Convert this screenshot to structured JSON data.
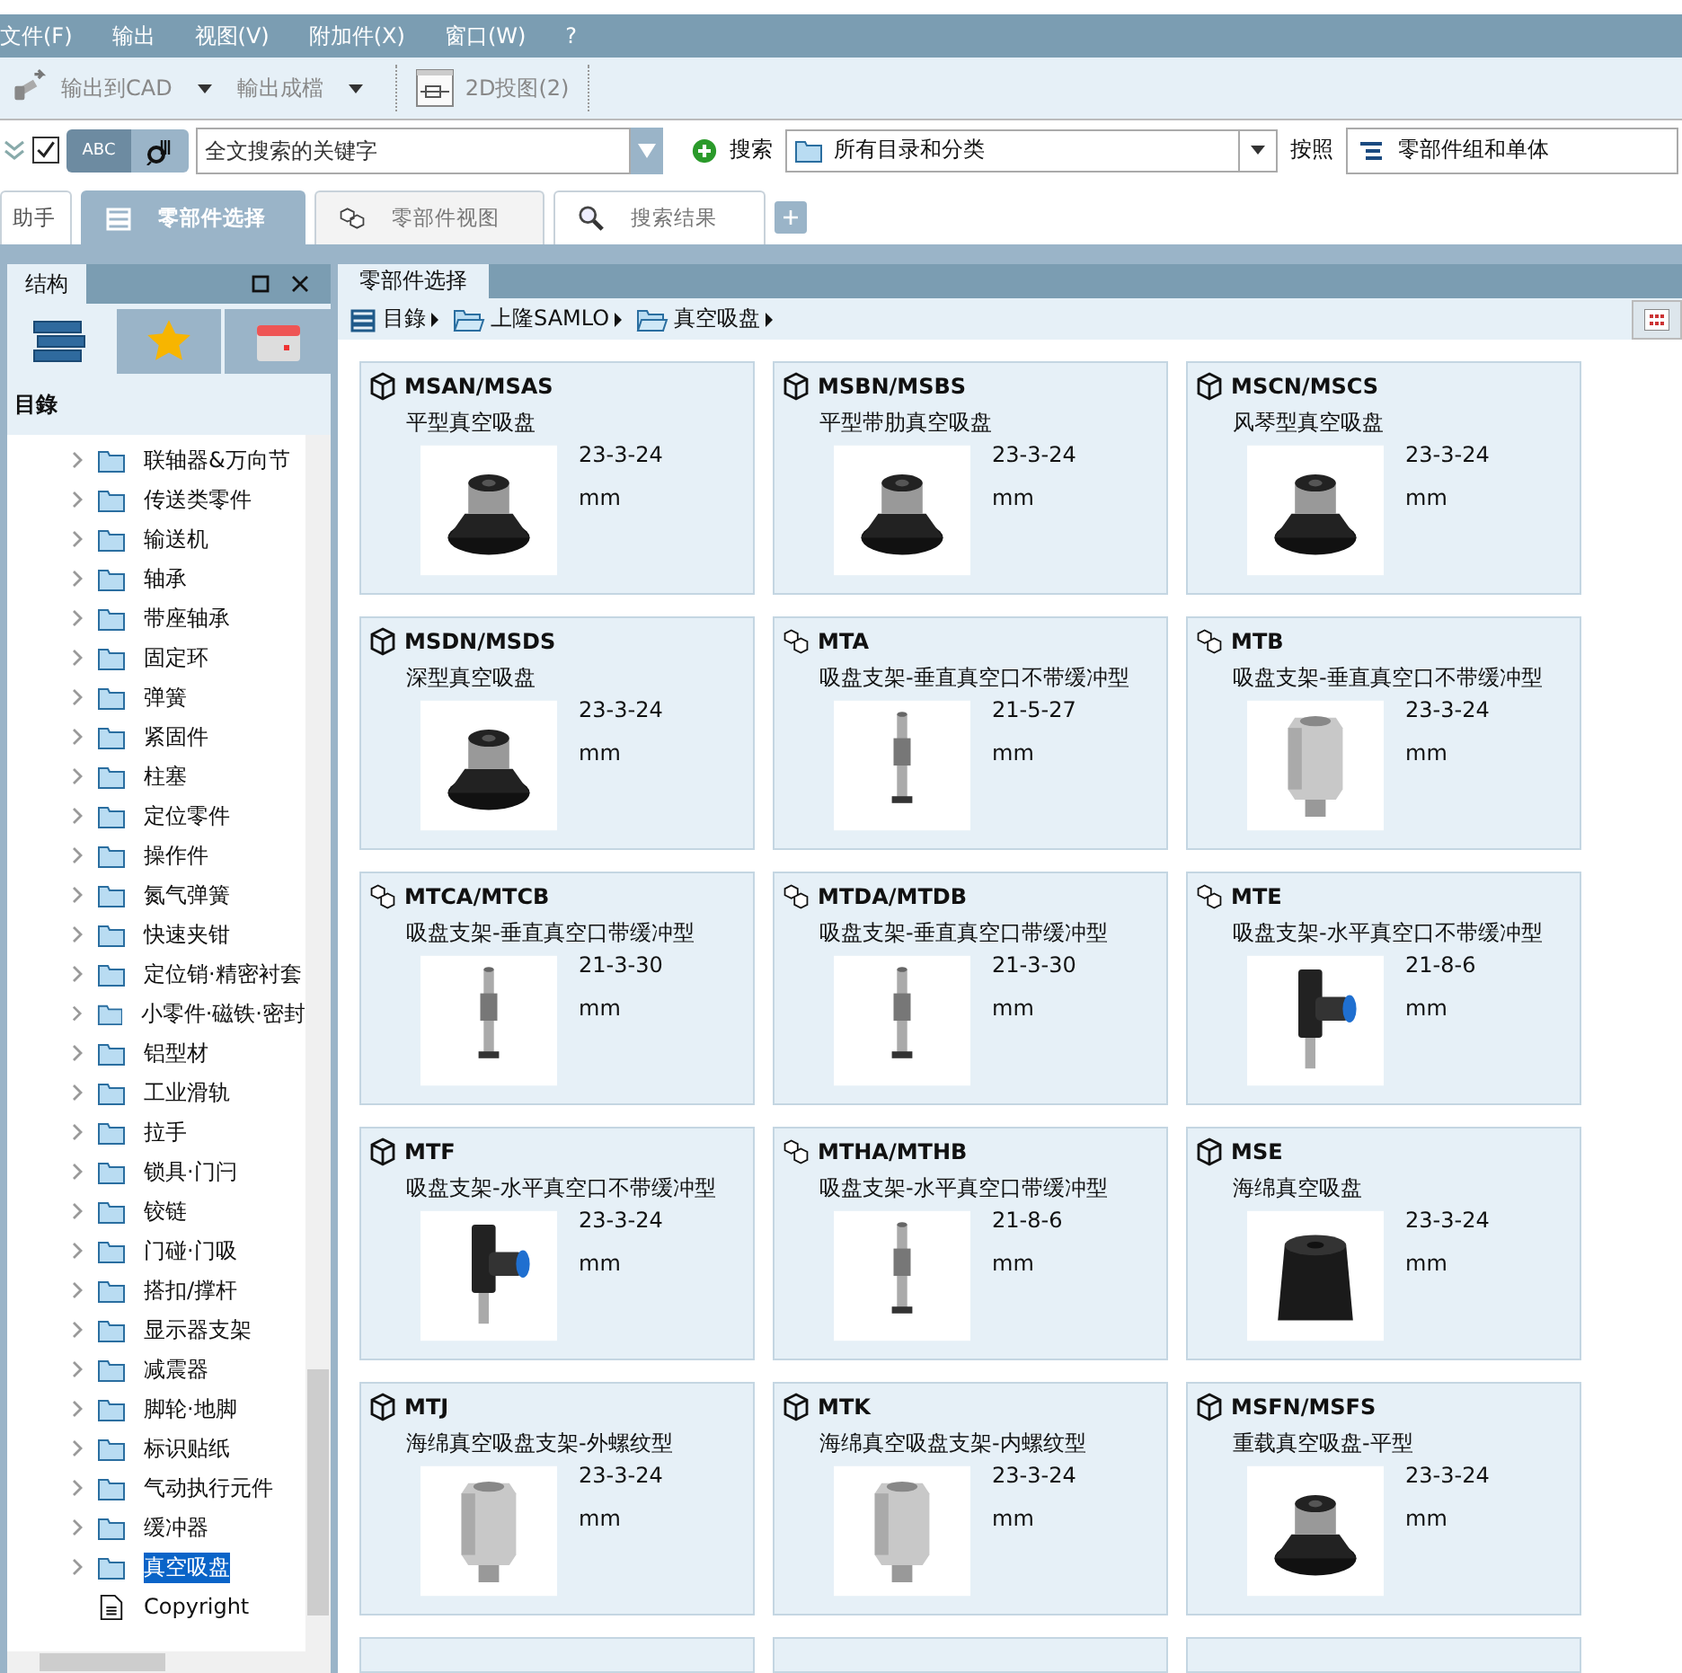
{
  "menu": [
    "文件(F)",
    "输出",
    "视图(V)",
    "附加件(X)",
    "窗口(W)",
    "?"
  ],
  "toolbar": {
    "export_cad": "输出到CAD",
    "export_doc": "輸出成檔",
    "view2d": "2D投图(2)"
  },
  "search": {
    "checked": true,
    "abc": "ABC",
    "placeholder": "全文搜索的关键字",
    "search_label": "搜索",
    "scope": "所有目录和分类",
    "by_label": "按照",
    "by_value": "零部件组和单体"
  },
  "tabs": [
    {
      "label": "助手",
      "selected": false
    },
    {
      "label": "零部件选择",
      "selected": true
    },
    {
      "label": "零部件视图",
      "selected": false
    },
    {
      "label": "搜索结果",
      "selected": false
    }
  ],
  "sidebar": {
    "title": "结构",
    "section": "目錄",
    "items": [
      {
        "label": "联轴器&万向节",
        "selected": false,
        "kind": "folder"
      },
      {
        "label": "传送类零件",
        "selected": false,
        "kind": "folder"
      },
      {
        "label": "输送机",
        "selected": false,
        "kind": "folder"
      },
      {
        "label": "轴承",
        "selected": false,
        "kind": "folder"
      },
      {
        "label": "带座轴承",
        "selected": false,
        "kind": "folder"
      },
      {
        "label": "固定环",
        "selected": false,
        "kind": "folder"
      },
      {
        "label": "弹簧",
        "selected": false,
        "kind": "folder"
      },
      {
        "label": "紧固件",
        "selected": false,
        "kind": "folder"
      },
      {
        "label": "柱塞",
        "selected": false,
        "kind": "folder"
      },
      {
        "label": "定位零件",
        "selected": false,
        "kind": "folder"
      },
      {
        "label": "操作件",
        "selected": false,
        "kind": "folder"
      },
      {
        "label": "氮气弹簧",
        "selected": false,
        "kind": "folder"
      },
      {
        "label": "快速夹钳",
        "selected": false,
        "kind": "folder"
      },
      {
        "label": "定位销·精密衬套",
        "selected": false,
        "kind": "folder"
      },
      {
        "label": "小零件·磁铁·密封",
        "selected": false,
        "kind": "folder"
      },
      {
        "label": "铝型材",
        "selected": false,
        "kind": "folder"
      },
      {
        "label": "工业滑轨",
        "selected": false,
        "kind": "folder"
      },
      {
        "label": "拉手",
        "selected": false,
        "kind": "folder"
      },
      {
        "label": "锁具·门闩",
        "selected": false,
        "kind": "folder"
      },
      {
        "label": "铰链",
        "selected": false,
        "kind": "folder"
      },
      {
        "label": "门碰·门吸",
        "selected": false,
        "kind": "folder"
      },
      {
        "label": "搭扣/撑杆",
        "selected": false,
        "kind": "folder"
      },
      {
        "label": "显示器支架",
        "selected": false,
        "kind": "folder"
      },
      {
        "label": "减震器",
        "selected": false,
        "kind": "folder"
      },
      {
        "label": "脚轮·地脚",
        "selected": false,
        "kind": "folder"
      },
      {
        "label": "标识贴纸",
        "selected": false,
        "kind": "folder"
      },
      {
        "label": "气动执行元件",
        "selected": false,
        "kind": "folder"
      },
      {
        "label": "缓冲器",
        "selected": false,
        "kind": "folder"
      },
      {
        "label": "真空吸盘",
        "selected": true,
        "kind": "folder"
      },
      {
        "label": "Copyright",
        "selected": false,
        "kind": "document"
      }
    ]
  },
  "content": {
    "tab": "零部件选择",
    "breadcrumb": [
      "目錄",
      "上隆SAMLO",
      "真空吸盘"
    ],
    "cards": [
      {
        "code": "MSAN/MSAS",
        "name": "平型真空吸盘",
        "date": "23-3-24",
        "unit": "mm",
        "kind": "part"
      },
      {
        "code": "MSBN/MSBS",
        "name": "平型带肋真空吸盘",
        "date": "23-3-24",
        "unit": "mm",
        "kind": "part"
      },
      {
        "code": "MSCN/MSCS",
        "name": "风琴型真空吸盘",
        "date": "23-3-24",
        "unit": "mm",
        "kind": "part"
      },
      {
        "code": "MSDN/MSDS",
        "name": "深型真空吸盘",
        "date": "23-3-24",
        "unit": "mm",
        "kind": "part"
      },
      {
        "code": "MTA",
        "name": "吸盘支架-垂直真空口不带缓冲型",
        "date": "21-5-27",
        "unit": "mm",
        "kind": "assembly"
      },
      {
        "code": "MTB",
        "name": "吸盘支架-垂直真空口不带缓冲型",
        "date": "23-3-24",
        "unit": "mm",
        "kind": "assembly"
      },
      {
        "code": "MTCA/MTCB",
        "name": "吸盘支架-垂直真空口带缓冲型",
        "date": "21-3-30",
        "unit": "mm",
        "kind": "assembly"
      },
      {
        "code": "MTDA/MTDB",
        "name": "吸盘支架-垂直真空口带缓冲型",
        "date": "21-3-30",
        "unit": "mm",
        "kind": "assembly"
      },
      {
        "code": "MTE",
        "name": "吸盘支架-水平真空口不带缓冲型",
        "date": "21-8-6",
        "unit": "mm",
        "kind": "assembly"
      },
      {
        "code": "MTF",
        "name": "吸盘支架-水平真空口不带缓冲型",
        "date": "23-3-24",
        "unit": "mm",
        "kind": "part"
      },
      {
        "code": "MTHA/MTHB",
        "name": "吸盘支架-水平真空口带缓冲型",
        "date": "21-8-6",
        "unit": "mm",
        "kind": "assembly"
      },
      {
        "code": "MSE",
        "name": "海绵真空吸盘",
        "date": "23-3-24",
        "unit": "mm",
        "kind": "part"
      },
      {
        "code": "MTJ",
        "name": "海绵真空吸盘支架-外螺纹型",
        "date": "23-3-24",
        "unit": "mm",
        "kind": "part"
      },
      {
        "code": "MTK",
        "name": "海绵真空吸盘支架-内螺纹型",
        "date": "23-3-24",
        "unit": "mm",
        "kind": "part"
      },
      {
        "code": "MSFN/MSFS",
        "name": "重载真空吸盘-平型",
        "date": "23-3-24",
        "unit": "mm",
        "kind": "part"
      }
    ]
  }
}
